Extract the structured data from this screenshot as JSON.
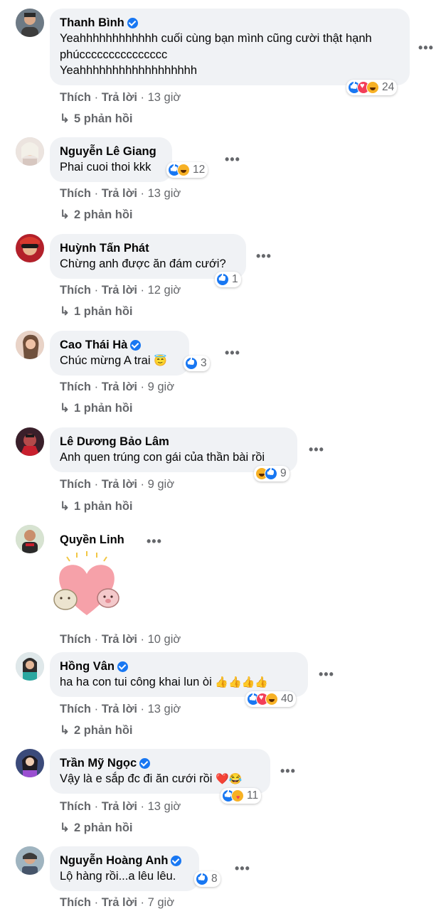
{
  "labels": {
    "like": "Thích",
    "reply": "Trả lời",
    "separator": "·",
    "more": "•••"
  },
  "colors": {
    "bubble": "#f0f2f5",
    "muted": "#65676b",
    "like_blue": "#1877f2",
    "love_red": "#f33e58",
    "haha_yellow": "#f7b125"
  },
  "comments": [
    {
      "name": "Thanh Bình",
      "verified": true,
      "text": "Yeahhhhhhhhhhhh cuối cùng bạn mình cũng cười thật hạnh phúccccccccccccccc\nYeahhhhhhhhhhhhhhhhhh",
      "reactions": [
        "like",
        "love",
        "haha"
      ],
      "reaction_count": "24",
      "time": "13 giờ",
      "replies": "5 phản hồi"
    },
    {
      "name": "Nguyễn Lê Giang",
      "verified": false,
      "text": "Phai cuoi thoi kkk",
      "reactions": [
        "like",
        "haha"
      ],
      "reaction_count": "12",
      "time": "13 giờ",
      "replies": "2 phản hồi"
    },
    {
      "name": "Huỳnh Tấn Phát",
      "verified": false,
      "text": "Chừng anh được ăn đám cưới?",
      "reactions": [
        "like"
      ],
      "reaction_count": "1",
      "time": "12 giờ",
      "replies": "1 phản hồi"
    },
    {
      "name": "Cao Thái Hà",
      "verified": true,
      "text": "Chúc mừng A trai",
      "emoji": "😇",
      "reactions": [
        "like"
      ],
      "reaction_count": "3",
      "time": "9 giờ",
      "replies": "1 phản hồi"
    },
    {
      "name": "Lê Dương Bảo Lâm",
      "verified": false,
      "text": "Anh quen trúng con gái của thần bài rồi",
      "reactions": [
        "haha",
        "like"
      ],
      "reaction_count": "9",
      "time": "9 giờ",
      "replies": "1 phản hồi"
    },
    {
      "name": "Quyền Linh",
      "verified": false,
      "sticker": "heart-couple-sticker",
      "time": "10 giờ"
    },
    {
      "name": "Hồng Vân",
      "verified": true,
      "text": "ha ha con tui công khai lun òi",
      "emoji": "👍👍👍👍",
      "reactions": [
        "like",
        "love",
        "haha"
      ],
      "reaction_count": "40",
      "time": "13 giờ",
      "replies": "2 phản hồi"
    },
    {
      "name": "Trần Mỹ Ngọc",
      "verified": true,
      "text": "Vậy là e sắp đc đi ăn cưới rồi",
      "emoji": "❤️😂",
      "reactions": [
        "like",
        "care"
      ],
      "reaction_count": "11",
      "time": "13 giờ",
      "replies": "2 phản hồi"
    },
    {
      "name": "Nguyễn Hoàng Anh",
      "verified": true,
      "text": "Lộ hàng rồi...a lêu lêu.",
      "reactions": [
        "like"
      ],
      "reaction_count": "8",
      "time": "7 giờ"
    }
  ]
}
